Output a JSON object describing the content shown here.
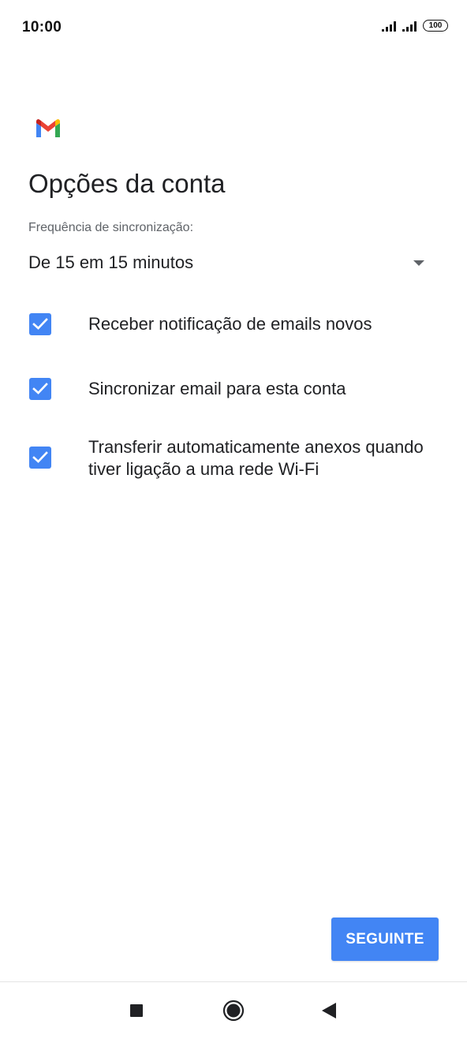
{
  "status_bar": {
    "time": "10:00",
    "battery": "100"
  },
  "app": {
    "logo_icon": "gmail-logo-icon",
    "title": "Opções da conta"
  },
  "sync": {
    "label": "Frequência de sincronização:",
    "selected": "De 15 em 15 minutos"
  },
  "options": [
    {
      "label": "Receber notificação de emails novos",
      "checked": true
    },
    {
      "label": "Sincronizar email para esta conta",
      "checked": true
    },
    {
      "label": "Transferir automaticamente anexos quando tiver ligação a uma rede Wi-Fi",
      "checked": true
    }
  ],
  "next_button": {
    "label": "SEGUINTE"
  },
  "colors": {
    "accent": "#4285f4",
    "text": "#202124",
    "secondary_text": "#5f6368"
  },
  "nav": {
    "icons": [
      "recent-apps-icon",
      "home-icon",
      "back-icon"
    ]
  }
}
